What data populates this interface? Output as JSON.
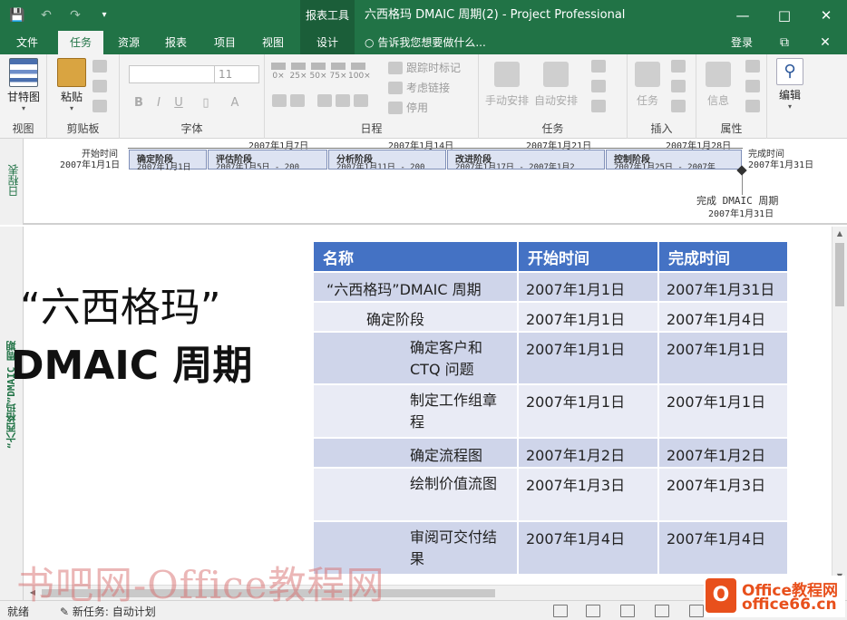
{
  "window": {
    "title": "六西格玛 DMAIC 周期(2) - Project Professional",
    "context_group": "报表工具"
  },
  "tabs": [
    {
      "label": "文件",
      "active": false
    },
    {
      "label": "任务",
      "active": true
    },
    {
      "label": "资源",
      "active": false
    },
    {
      "label": "报表",
      "active": false
    },
    {
      "label": "项目",
      "active": false
    },
    {
      "label": "视图",
      "active": false
    },
    {
      "label": "设计",
      "active": false
    }
  ],
  "tell_me": "告诉我您想要做什么...",
  "login": "登录",
  "ribbon": {
    "view": {
      "gantt": "甘特图",
      "label": "视图"
    },
    "clipboard": {
      "paste": "粘贴",
      "label": "剪贴板"
    },
    "font": {
      "font_size": "11",
      "label": "字体"
    },
    "schedule": {
      "percents": [
        "0×",
        "25×",
        "50×",
        "75×",
        "100×"
      ],
      "track": "跟踪时标记",
      "respect_links": "考虑链接",
      "inactivate": "停用",
      "label": "日程"
    },
    "tasks": {
      "manual": "手动安排",
      "auto": "自动安排",
      "task": "任务",
      "label": "任务"
    },
    "insert": {
      "label": "插入"
    },
    "properties": {
      "info": "信息",
      "label": "属性"
    },
    "editing": {
      "label": "编辑"
    }
  },
  "timeline": {
    "side_label": "日程表",
    "scale": [
      "2007年1月7日",
      "2007年1月14日",
      "2007年1月21日",
      "2007年1月28日"
    ],
    "start_label": "开始时间",
    "start_date": "2007年1月1日",
    "finish_label": "完成时间",
    "finish_date": "2007年1月31日",
    "milestone_name": "完成 DMAIC 周期",
    "milestone_date": "2007年1月31日",
    "phases": [
      {
        "name": "确定阶段",
        "dates": "2007年1月1日"
      },
      {
        "name": "评估阶段",
        "dates": "2007年1月5日 - 200"
      },
      {
        "name": "分析阶段",
        "dates": "2007年1月11日 - 200"
      },
      {
        "name": "改进阶段",
        "dates": "2007年1月17日 - 2007年1月2"
      },
      {
        "name": "控制阶段",
        "dates": "2007年1月25日 - 2007年"
      }
    ]
  },
  "report": {
    "side_label": "“六西格玛”DMAIC 周期",
    "title_line1": "“六西格玛”",
    "title_line2": "DMAIC 周期",
    "columns": [
      "名称",
      "开始时间",
      "完成时间"
    ],
    "rows": [
      {
        "name": "“六西格玛”DMAIC 周期",
        "start": "2007年1月1日",
        "finish": "2007年1月31日",
        "indent": 0
      },
      {
        "name": "确定阶段",
        "start": "2007年1月1日",
        "finish": "2007年1月4日",
        "indent": 1
      },
      {
        "name": "确定客户和CTQ 问题",
        "start": "2007年1月1日",
        "finish": "2007年1月1日",
        "indent": 2
      },
      {
        "name": "制定工作组章程",
        "start": "2007年1月1日",
        "finish": "2007年1月1日",
        "indent": 2
      },
      {
        "name": "确定流程图",
        "start": "2007年1月2日",
        "finish": "2007年1月2日",
        "indent": 2
      },
      {
        "name": "绘制价值流图",
        "start": "2007年1月3日",
        "finish": "2007年1月3日",
        "indent": 2
      },
      {
        "name": "审阅可交付结果",
        "start": "2007年1月4日",
        "finish": "2007年1月4日",
        "indent": 2
      }
    ]
  },
  "status": {
    "ready": "就绪",
    "new_task": "新任务: 自动计划"
  },
  "watermark": "书吧网-Office教程网",
  "logo": {
    "line1": "Office教程网",
    "line2": "office66.cn"
  }
}
